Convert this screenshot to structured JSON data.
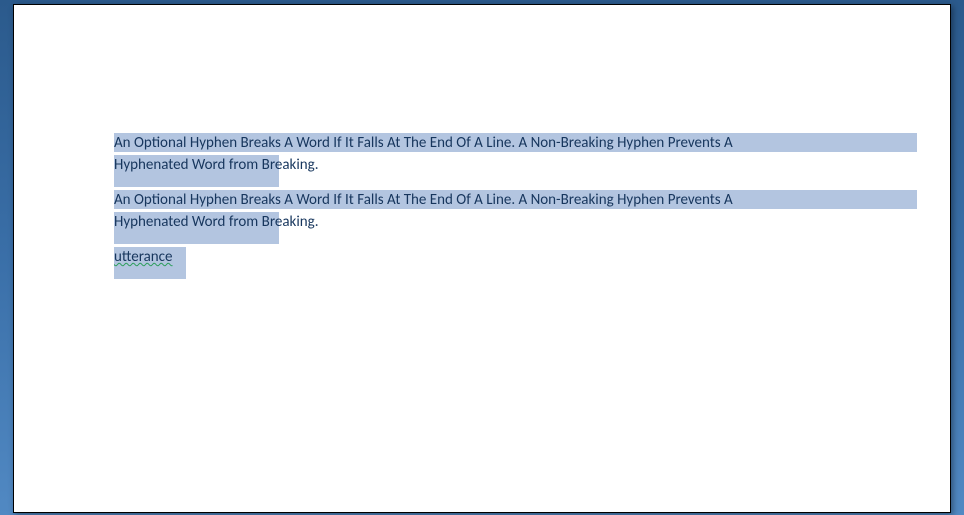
{
  "document": {
    "paragraphs": [
      {
        "line1": "An Optional Hyphen Breaks A Word If It Falls At The End Of A Line. A Non-Breaking Hyphen Prevents A",
        "line2_part1": "Hyphenated Word ",
        "line2_part2": "from Breaking."
      },
      {
        "line1": "An Optional Hyphen Breaks A Word If It Falls At The End Of A Line. A Non-Breaking Hyphen Prevents A",
        "line2_part1": "Hyphenated Word ",
        "line2_part2": "from Breaking."
      },
      {
        "word": "utterance"
      }
    ]
  }
}
